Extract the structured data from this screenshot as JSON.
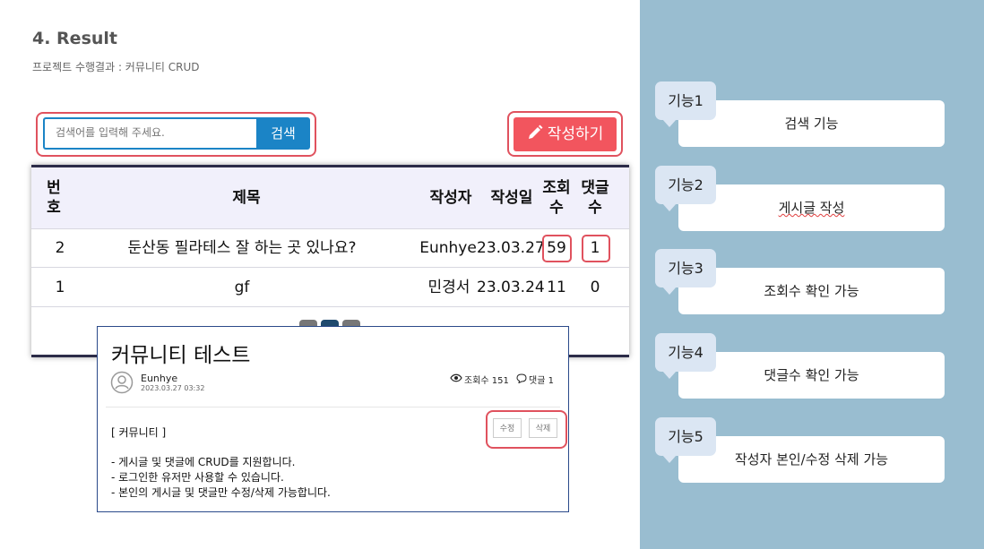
{
  "header": {
    "title": "4. Result",
    "subtitle": "프로젝트 수행결과 : 커뮤니티 CRUD"
  },
  "board": {
    "search_placeholder": "검색어를 입력해 주세요.",
    "search_button": "검색",
    "write_button": "작성하기",
    "columns": [
      "번호",
      "제목",
      "작성자",
      "작성일",
      "조회수",
      "댓글수"
    ],
    "column_lines": {
      "no": [
        "번",
        "호"
      ],
      "views": [
        "조회",
        "수"
      ],
      "comments": [
        "댓글",
        "수"
      ]
    },
    "rows": [
      {
        "no": "2",
        "title": "둔산동 필라테스 잘 하는 곳 있나요?",
        "author": "Eunhye",
        "date": "23.03.27",
        "views": "59",
        "comments": "1"
      },
      {
        "no": "1",
        "title": "gf",
        "author": "민경서",
        "date": "23.03.24",
        "views": "11",
        "comments": "0"
      }
    ]
  },
  "post": {
    "title": "커뮤니티 테스트",
    "author": "Eunhye",
    "date": "2023.03.27 03:32",
    "views": "조회수 151",
    "comments": "댓글 1",
    "edit_button": "수정",
    "delete_button": "삭제",
    "category": "[ 커뮤니티 ]",
    "body_lines": [
      "- 게시글 및 댓글에 CRUD를 지원합니다.",
      "- 로그인한 유저만 사용할 수 있습니다.",
      "- 본인의 게시글 및 댓글만 수정/삭제 가능합니다."
    ]
  },
  "features": [
    {
      "tag": "기능1",
      "desc": "검색 기능"
    },
    {
      "tag": "기능2",
      "desc": "게시글 작성"
    },
    {
      "tag": "기능3",
      "desc": "조회수 확인 가능"
    },
    {
      "tag": "기능4",
      "desc": "댓글수 확인 가능"
    },
    {
      "tag": "기능5",
      "desc": "작성자 본인/수정 삭제 가능"
    }
  ],
  "colors": {
    "primary": "#1b84c6",
    "accent_red": "#f2555e",
    "highlight": "#e0525e",
    "panel": "#99bdd0"
  }
}
